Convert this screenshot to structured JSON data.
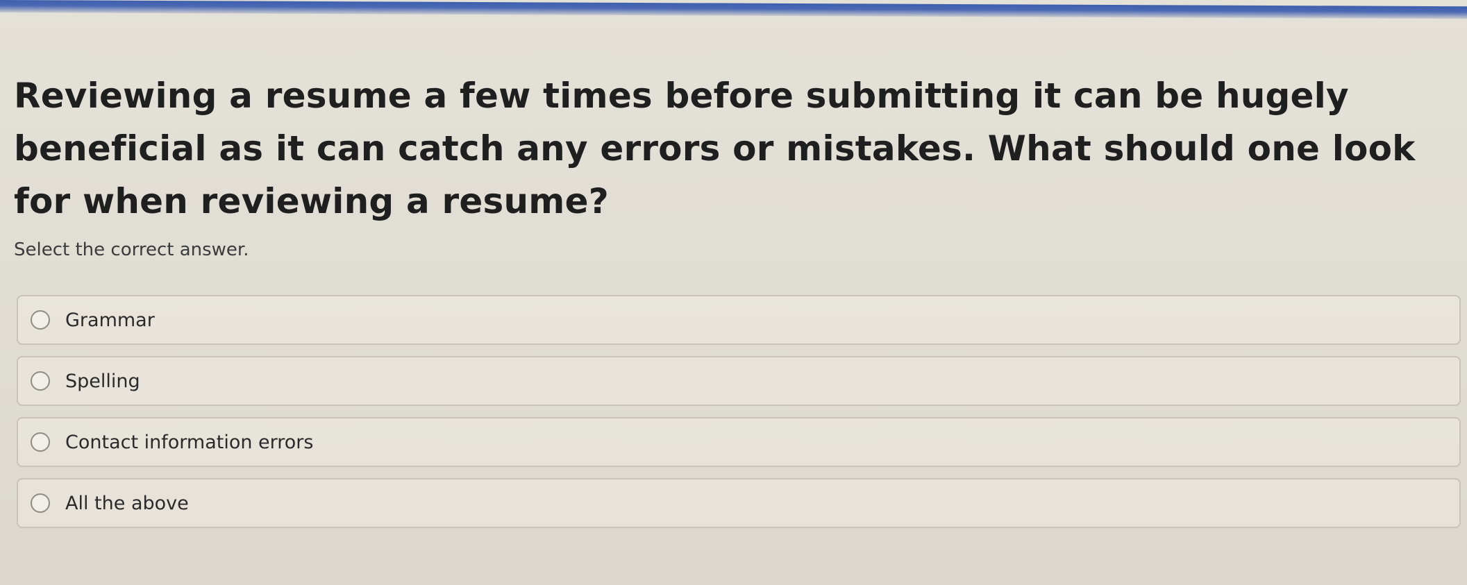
{
  "question": {
    "text": "Reviewing a resume a few times before submitting it can be hugely beneficial as it can catch any errors or mistakes. What should one look for when reviewing a resume?"
  },
  "instruction": "Select the correct answer.",
  "options": [
    {
      "label": "Grammar",
      "selected": false
    },
    {
      "label": "Spelling",
      "selected": false
    },
    {
      "label": "Contact information errors",
      "selected": false
    },
    {
      "label": "All the above",
      "selected": false
    }
  ],
  "colors": {
    "accent_bar": "#4566b2",
    "background": "#e2dfd6"
  }
}
